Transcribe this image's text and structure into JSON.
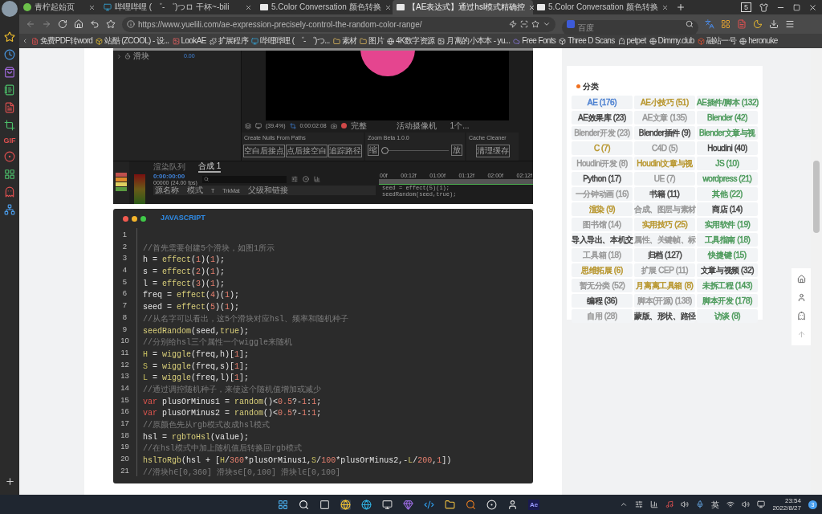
{
  "tabs": [
    {
      "label": "青柠起始页",
      "selected": false
    },
    {
      "label": "哔哩哔哩 ( ゜- ゜)つロ 干杯~-bili",
      "selected": false
    },
    {
      "label": "5.Color Conversation 颜色转换",
      "selected": false
    },
    {
      "label": "【AE表达式】通过hsl模式精确控",
      "selected": true
    },
    {
      "label": "5.Color Conversation 颜色转换",
      "selected": false
    }
  ],
  "window_count": "5",
  "address": "https://www.yuelili.com/ae-expression-precisely-control-the-random-color-range/",
  "search": {
    "placeholder": "百度"
  },
  "bookmarks": [
    "免费PDF转word",
    "站酷 (ZCOOL) - 设...",
    "LookAE",
    "扩展程序",
    "哔哩哔哩 ( ゜- ゜)つ...",
    "素材",
    "图片",
    "4K数字资源",
    "月离的小本本 - yu...",
    "Free Fonts",
    "Three D Scans",
    "petpet",
    "Dimmy.club",
    "融站一号",
    "heronuke"
  ],
  "browser_sidebar": {
    "gif_label": "GIF"
  },
  "ae_screenshot": {
    "property": {
      "name": "滑块",
      "value": "0.00"
    },
    "viewer_toolbar": {
      "zoom": "(39.4%)",
      "timecode": "0:00:02:08",
      "resolution": "完整",
      "camera": "活动摄像机",
      "views": "1个..."
    },
    "panels": [
      {
        "title": "Create Nulls From Paths",
        "kind": "buttons",
        "buttons": [
          "空白后接点",
          "点后接空白",
          "追踪路径"
        ]
      },
      {
        "title": "Zoom Beta 1.0.0",
        "kind": "slider",
        "left": "缩",
        "right": "放",
        "level": 0
      },
      {
        "title": "Cache Cleaner",
        "kind": "buttons",
        "buttons": [
          "清理缓存"
        ]
      }
    ],
    "timeline": {
      "tabs": [
        {
          "label": "渲染队列",
          "selected": false
        },
        {
          "label": "合成 1",
          "selected": true
        }
      ],
      "time": "0:00:00:00",
      "fps": "00000 (24.00 fps)",
      "columns": [
        "源名称",
        "模式",
        "T",
        "TrkMat",
        "父级和链接"
      ],
      "ruler": [
        "00f",
        "00:12f",
        "01:00f",
        "01:12f",
        "02:00f",
        "02:12f"
      ],
      "expression": [
        "seed = effect(5)(1);",
        "seedRandom(seed,true);"
      ]
    }
  },
  "code_block": {
    "language": "JAVASCRIPT",
    "lines": [
      {
        "number": "1"
      },
      {
        "number": "2",
        "tokens": [
          {
            "kind": "c",
            "text": "//首先需要创建5个滑块，如图1所示"
          }
        ]
      },
      {
        "number": "3",
        "tokens": [
          {
            "kind": "p",
            "text": "h = "
          },
          {
            "kind": "f",
            "text": "effect"
          },
          {
            "kind": "p",
            "text": "("
          },
          {
            "kind": "n",
            "text": "1"
          },
          {
            "kind": "p",
            "text": ")("
          },
          {
            "kind": "n",
            "text": "1"
          },
          {
            "kind": "p",
            "text": ");"
          }
        ]
      },
      {
        "number": "4",
        "tokens": [
          {
            "kind": "p",
            "text": "s = "
          },
          {
            "kind": "f",
            "text": "effect"
          },
          {
            "kind": "p",
            "text": "("
          },
          {
            "kind": "n",
            "text": "2"
          },
          {
            "kind": "p",
            "text": ")("
          },
          {
            "kind": "n",
            "text": "1"
          },
          {
            "kind": "p",
            "text": ");"
          }
        ]
      },
      {
        "number": "5",
        "tokens": [
          {
            "kind": "p",
            "text": "l = "
          },
          {
            "kind": "f",
            "text": "effect"
          },
          {
            "kind": "p",
            "text": "("
          },
          {
            "kind": "n",
            "text": "3"
          },
          {
            "kind": "p",
            "text": ")("
          },
          {
            "kind": "n",
            "text": "1"
          },
          {
            "kind": "p",
            "text": ");"
          }
        ]
      },
      {
        "number": "6",
        "tokens": [
          {
            "kind": "p",
            "text": "freq = "
          },
          {
            "kind": "f",
            "text": "effect"
          },
          {
            "kind": "p",
            "text": "("
          },
          {
            "kind": "n",
            "text": "4"
          },
          {
            "kind": "p",
            "text": ")("
          },
          {
            "kind": "n",
            "text": "1"
          },
          {
            "kind": "p",
            "text": ");"
          }
        ]
      },
      {
        "number": "7",
        "tokens": [
          {
            "kind": "p",
            "text": "seed = "
          },
          {
            "kind": "f",
            "text": "effect"
          },
          {
            "kind": "p",
            "text": "("
          },
          {
            "kind": "n",
            "text": "5"
          },
          {
            "kind": "p",
            "text": ")("
          },
          {
            "kind": "n",
            "text": "1"
          },
          {
            "kind": "p",
            "text": ");"
          }
        ]
      },
      {
        "number": "8",
        "tokens": [
          {
            "kind": "c",
            "text": "//从名字可以看出，这5个滑块对应hsl、频率和随机种子"
          }
        ]
      },
      {
        "number": "9",
        "tokens": [
          {
            "kind": "f",
            "text": "seedRandom"
          },
          {
            "kind": "p",
            "text": "(seed,"
          },
          {
            "kind": "f",
            "text": "true"
          },
          {
            "kind": "p",
            "text": ");"
          }
        ]
      },
      {
        "number": "10",
        "tokens": [
          {
            "kind": "c",
            "text": "//分别给hsl三个属性一个wiggle来随机"
          }
        ]
      },
      {
        "number": "11",
        "tokens": [
          {
            "kind": "v",
            "text": "H"
          },
          {
            "kind": "p",
            "text": " = "
          },
          {
            "kind": "f",
            "text": "wiggle"
          },
          {
            "kind": "p",
            "text": "(freq,h)["
          },
          {
            "kind": "n",
            "text": "1"
          },
          {
            "kind": "p",
            "text": "];"
          }
        ]
      },
      {
        "number": "12",
        "tokens": [
          {
            "kind": "v",
            "text": "S"
          },
          {
            "kind": "p",
            "text": " = "
          },
          {
            "kind": "f",
            "text": "wiggle"
          },
          {
            "kind": "p",
            "text": "(freq,s)["
          },
          {
            "kind": "n",
            "text": "1"
          },
          {
            "kind": "p",
            "text": "];"
          }
        ]
      },
      {
        "number": "13",
        "tokens": [
          {
            "kind": "v",
            "text": "L"
          },
          {
            "kind": "p",
            "text": " = "
          },
          {
            "kind": "f",
            "text": "wiggle"
          },
          {
            "kind": "p",
            "text": "(freq,l)["
          },
          {
            "kind": "n",
            "text": "1"
          },
          {
            "kind": "p",
            "text": "];"
          }
        ]
      },
      {
        "number": "14",
        "tokens": [
          {
            "kind": "c",
            "text": "//通过调控随机种子，来使这个随机值增加或减少"
          }
        ]
      },
      {
        "number": "15",
        "tokens": [
          {
            "kind": "k",
            "text": "var"
          },
          {
            "kind": "p",
            "text": " plusOrMinus1 = "
          },
          {
            "kind": "f",
            "text": "random"
          },
          {
            "kind": "p",
            "text": "()<"
          },
          {
            "kind": "n",
            "text": "0.5"
          },
          {
            "kind": "p",
            "text": "?-"
          },
          {
            "kind": "n",
            "text": "1"
          },
          {
            "kind": "p",
            "text": ":"
          },
          {
            "kind": "n",
            "text": "1"
          },
          {
            "kind": "p",
            "text": ";"
          }
        ]
      },
      {
        "number": "16",
        "tokens": [
          {
            "kind": "k",
            "text": "var"
          },
          {
            "kind": "p",
            "text": " plusOrMinus2 = "
          },
          {
            "kind": "f",
            "text": "random"
          },
          {
            "kind": "p",
            "text": "()<"
          },
          {
            "kind": "n",
            "text": "0.5"
          },
          {
            "kind": "p",
            "text": "?-"
          },
          {
            "kind": "n",
            "text": "1"
          },
          {
            "kind": "p",
            "text": ":"
          },
          {
            "kind": "n",
            "text": "1"
          },
          {
            "kind": "p",
            "text": ";"
          }
        ]
      },
      {
        "number": "17",
        "tokens": [
          {
            "kind": "c",
            "text": "//原颜色先从rgb模式改成hsl模式"
          }
        ]
      },
      {
        "number": "18",
        "tokens": [
          {
            "kind": "p",
            "text": "hsl = "
          },
          {
            "kind": "f",
            "text": "rgbToHsl"
          },
          {
            "kind": "p",
            "text": "(value);"
          }
        ]
      },
      {
        "number": "19",
        "tokens": [
          {
            "kind": "c",
            "text": "//在hsl模式中加上随机值后转换回rgb模式"
          }
        ]
      },
      {
        "number": "20",
        "tokens": [
          {
            "kind": "f",
            "text": "hslToRgb"
          },
          {
            "kind": "p",
            "text": "(hsl + ["
          },
          {
            "kind": "v",
            "text": "H"
          },
          {
            "kind": "p",
            "text": "/"
          },
          {
            "kind": "n",
            "text": "360"
          },
          {
            "kind": "p",
            "text": "*plusOrMinus1,"
          },
          {
            "kind": "v",
            "text": "S"
          },
          {
            "kind": "p",
            "text": "/"
          },
          {
            "kind": "n",
            "text": "100"
          },
          {
            "kind": "p",
            "text": "*plusOrMinus2,-"
          },
          {
            "kind": "v",
            "text": "L"
          },
          {
            "kind": "p",
            "text": "/"
          },
          {
            "kind": "n",
            "text": "200"
          },
          {
            "kind": "p",
            "text": ","
          },
          {
            "kind": "n",
            "text": "1"
          },
          {
            "kind": "p",
            "text": "])"
          }
        ]
      },
      {
        "number": "21",
        "tokens": [
          {
            "kind": "c",
            "text": "//滑块h∈[0,360] 滑块s∈[0,100] 滑块l∈[0,100]"
          }
        ]
      }
    ]
  },
  "sidebar": {
    "title": "分类",
    "categories": [
      {
        "label": "AE (176)",
        "color": "#4a7fd0"
      },
      {
        "label": "AE小技巧 (51)",
        "color": "#b8962e"
      },
      {
        "label": "AE插件/脚本 (132)",
        "color": "#4c9a5b"
      },
      {
        "label": "AE效果库 (23)",
        "color": "#444444"
      },
      {
        "label": "AE文章 (135)",
        "color": "#999999"
      },
      {
        "label": "Blender (42)",
        "color": "#4c9a5b"
      },
      {
        "label": "Blender开发 (23)",
        "color": "#999999"
      },
      {
        "label": "Blender插件 (9)",
        "color": "#444444"
      },
      {
        "label": "Blender文章与视",
        "color": "#4c9a5b"
      },
      {
        "label": "C (7)",
        "color": "#b8962e"
      },
      {
        "label": "C4D (5)",
        "color": "#999999"
      },
      {
        "label": "Houdini (40)",
        "color": "#444444"
      },
      {
        "label": "Houdini开发 (8)",
        "color": "#999999"
      },
      {
        "label": "Houdini文章与视",
        "color": "#b8962e"
      },
      {
        "label": "JS (10)",
        "color": "#4c9a5b"
      },
      {
        "label": "Python (17)",
        "color": "#444444"
      },
      {
        "label": "UE (7)",
        "color": "#999999"
      },
      {
        "label": "wordpress (21)",
        "color": "#4c9a5b"
      },
      {
        "label": "一分钟动画 (16)",
        "color": "#999999"
      },
      {
        "label": "书籍 (11)",
        "color": "#444444"
      },
      {
        "label": "其他 (22)",
        "color": "#4c9a5b"
      },
      {
        "label": "渲染 (9)",
        "color": "#b8962e"
      },
      {
        "label": "合成、图层与素材",
        "color": "#999999"
      },
      {
        "label": "商店 (14)",
        "color": "#444444"
      },
      {
        "label": "图书馆 (14)",
        "color": "#999999"
      },
      {
        "label": "实用技巧 (25)",
        "color": "#b8962e"
      },
      {
        "label": "实用软件 (19)",
        "color": "#4c9a5b"
      },
      {
        "label": "导入导出、本机交",
        "color": "#444444"
      },
      {
        "label": "属性、关键帧、标",
        "color": "#999999"
      },
      {
        "label": "工具指南 (18)",
        "color": "#4c9a5b"
      },
      {
        "label": "工具箱 (18)",
        "color": "#999999"
      },
      {
        "label": "归档 (127)",
        "color": "#444444"
      },
      {
        "label": "快捷键 (15)",
        "color": "#4c9a5b"
      },
      {
        "label": "思维拓展 (6)",
        "color": "#b8962e"
      },
      {
        "label": "扩展 CEP (11)",
        "color": "#999999"
      },
      {
        "label": "文章与视频 (32)",
        "color": "#444444"
      },
      {
        "label": "暂无分类 (52)",
        "color": "#999999"
      },
      {
        "label": "月离离工具箱 (8)",
        "color": "#b8962e"
      },
      {
        "label": "未拆工程 (143)",
        "color": "#4c9a5b"
      },
      {
        "label": "编程 (36)",
        "color": "#444444"
      },
      {
        "label": "脚本(开源) (138)",
        "color": "#999999"
      },
      {
        "label": "脚本开发 (178)",
        "color": "#4c9a5b"
      },
      {
        "label": "自用 (28)",
        "color": "#999999"
      },
      {
        "label": "蒙版、形状、路径",
        "color": "#444444"
      },
      {
        "label": "访谈 (8)",
        "color": "#4c9a5b"
      }
    ]
  },
  "taskbar": {
    "ae_label": "Ae",
    "ime": "英",
    "time": "23:54",
    "date": "2022/8/27",
    "notifications": "3"
  }
}
